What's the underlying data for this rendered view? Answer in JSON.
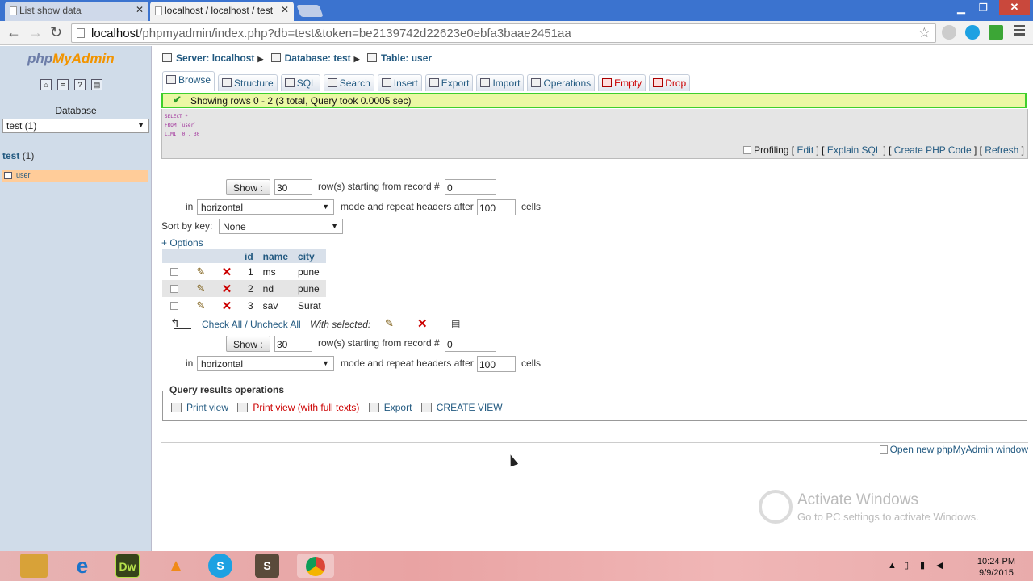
{
  "browser": {
    "tabs": [
      {
        "title": "List show data"
      },
      {
        "title": "localhost / localhost / test"
      }
    ],
    "url_host": "localhost",
    "url_path": "/phpmyadmin/index.php?db=test&token=be2139742d22623e0ebfa3baae2451aa"
  },
  "sidebar": {
    "logo_a": "php",
    "logo_b": "MyAdmin",
    "database_label": "Database",
    "database_value": "test (1)",
    "tree_db": "test",
    "tree_db_count": "(1)",
    "table_item": "user"
  },
  "breadcrumb": {
    "server": "Server: localhost",
    "database": "Database: test",
    "table": "Table: user"
  },
  "tabs": [
    "Browse",
    "Structure",
    "SQL",
    "Search",
    "Insert",
    "Export",
    "Import",
    "Operations",
    "Empty",
    "Drop"
  ],
  "result": {
    "message": "Showing rows 0 - 2 (3 total, Query took 0.0005 sec)",
    "sql_lines": [
      "SELECT *",
      "FROM `user`",
      "LIMIT 0 , 30"
    ],
    "profiling": "Profiling",
    "links": {
      "edit": "Edit",
      "explain": "Explain SQL",
      "php": "Create PHP Code",
      "refresh": "Refresh"
    }
  },
  "nav": {
    "show_label": "Show :",
    "rows_value": "30",
    "rows_text": "row(s) starting from record #",
    "start_value": "0",
    "in_label": "in",
    "mode_value": "horizontal",
    "mode_text": "mode and repeat headers after",
    "repeat_value": "100",
    "cells_text": "cells",
    "sort_label": "Sort by key:",
    "sort_value": "None",
    "options_link": "+ Options"
  },
  "table": {
    "columns": [
      "id",
      "name",
      "city"
    ],
    "rows": [
      {
        "id": "1",
        "name": "ms",
        "city": "pune"
      },
      {
        "id": "2",
        "name": "nd",
        "city": "pune"
      },
      {
        "id": "3",
        "name": "sav",
        "city": "Surat"
      }
    ]
  },
  "bulk": {
    "check_all": "Check All / Uncheck All",
    "with_selected": "With selected:"
  },
  "query_ops": {
    "legend": "Query results operations",
    "print_view": "Print view",
    "print_full": "Print view (with full texts)",
    "export": "Export",
    "create_view": "CREATE VIEW"
  },
  "open_new_window": "Open new phpMyAdmin window",
  "watermark": {
    "title": "Activate Windows",
    "subtitle": "Go to PC settings to activate Windows."
  },
  "taskbar": {
    "dw_label": "Dw",
    "time": "10:24 PM",
    "date": "9/9/2015"
  }
}
